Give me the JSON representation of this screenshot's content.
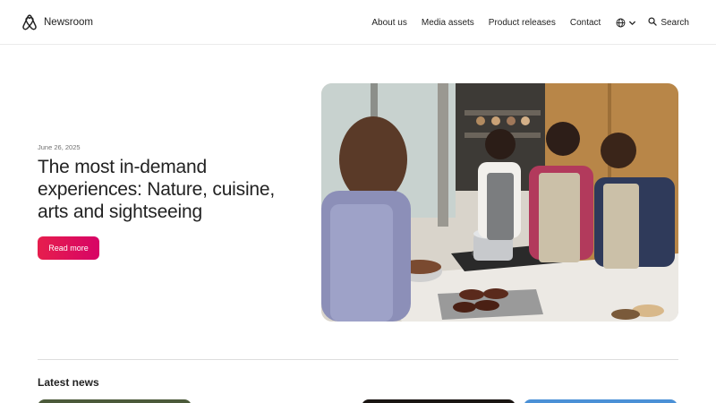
{
  "header": {
    "brand_label": "Newsroom",
    "brand_icon": "airbnb-logo-icon",
    "nav": {
      "about": "About us",
      "media": "Media assets",
      "product": "Product releases",
      "contact": "Contact",
      "search": "Search"
    },
    "language_icon": "globe-icon"
  },
  "hero": {
    "date": "June 26, 2025",
    "title": "The most in-demand experiences: Nature, cuisine, arts and sightseeing",
    "button_label": "Read more",
    "button_color": "#e61e4d"
  },
  "latest": {
    "heading": "Latest news"
  }
}
